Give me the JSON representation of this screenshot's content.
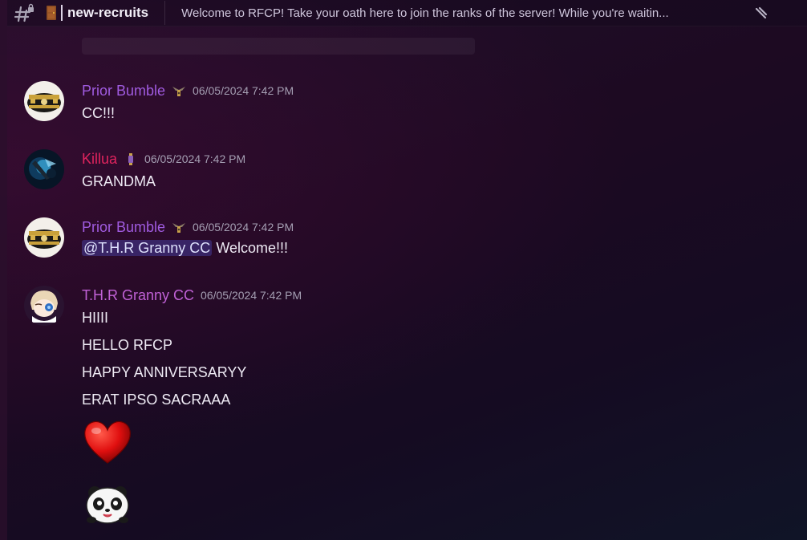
{
  "header": {
    "channel_name": "new-recruits",
    "topic": "Welcome to RFCP! Take your oath here to join the ranks of the server! While you're waitin..."
  },
  "messages": [
    {
      "author": "Prior Bumble",
      "author_color": "#a05be0",
      "timestamp": "06/05/2024 7:42 PM",
      "lines": [
        "CC!!!"
      ]
    },
    {
      "author": "Killua",
      "author_color": "#e0245e",
      "timestamp": "06/05/2024 7:42 PM",
      "lines": [
        "GRANDMA"
      ]
    },
    {
      "author": "Prior Bumble",
      "author_color": "#a05be0",
      "timestamp": "06/05/2024 7:42 PM",
      "mention": "@T.H.R Granny CC",
      "lines": [
        "Welcome!!!"
      ]
    },
    {
      "author": "T.H.R Granny CC",
      "author_color": "#c061d6",
      "timestamp": "06/05/2024 7:42 PM",
      "lines": [
        "HIIII",
        "HELLO RFCP",
        "HAPPY ANNIVERSARYY",
        "ERAT IPSO SACRAAA"
      ],
      "emojis": [
        "red-heart-emoji",
        "panda-emoji"
      ]
    }
  ]
}
